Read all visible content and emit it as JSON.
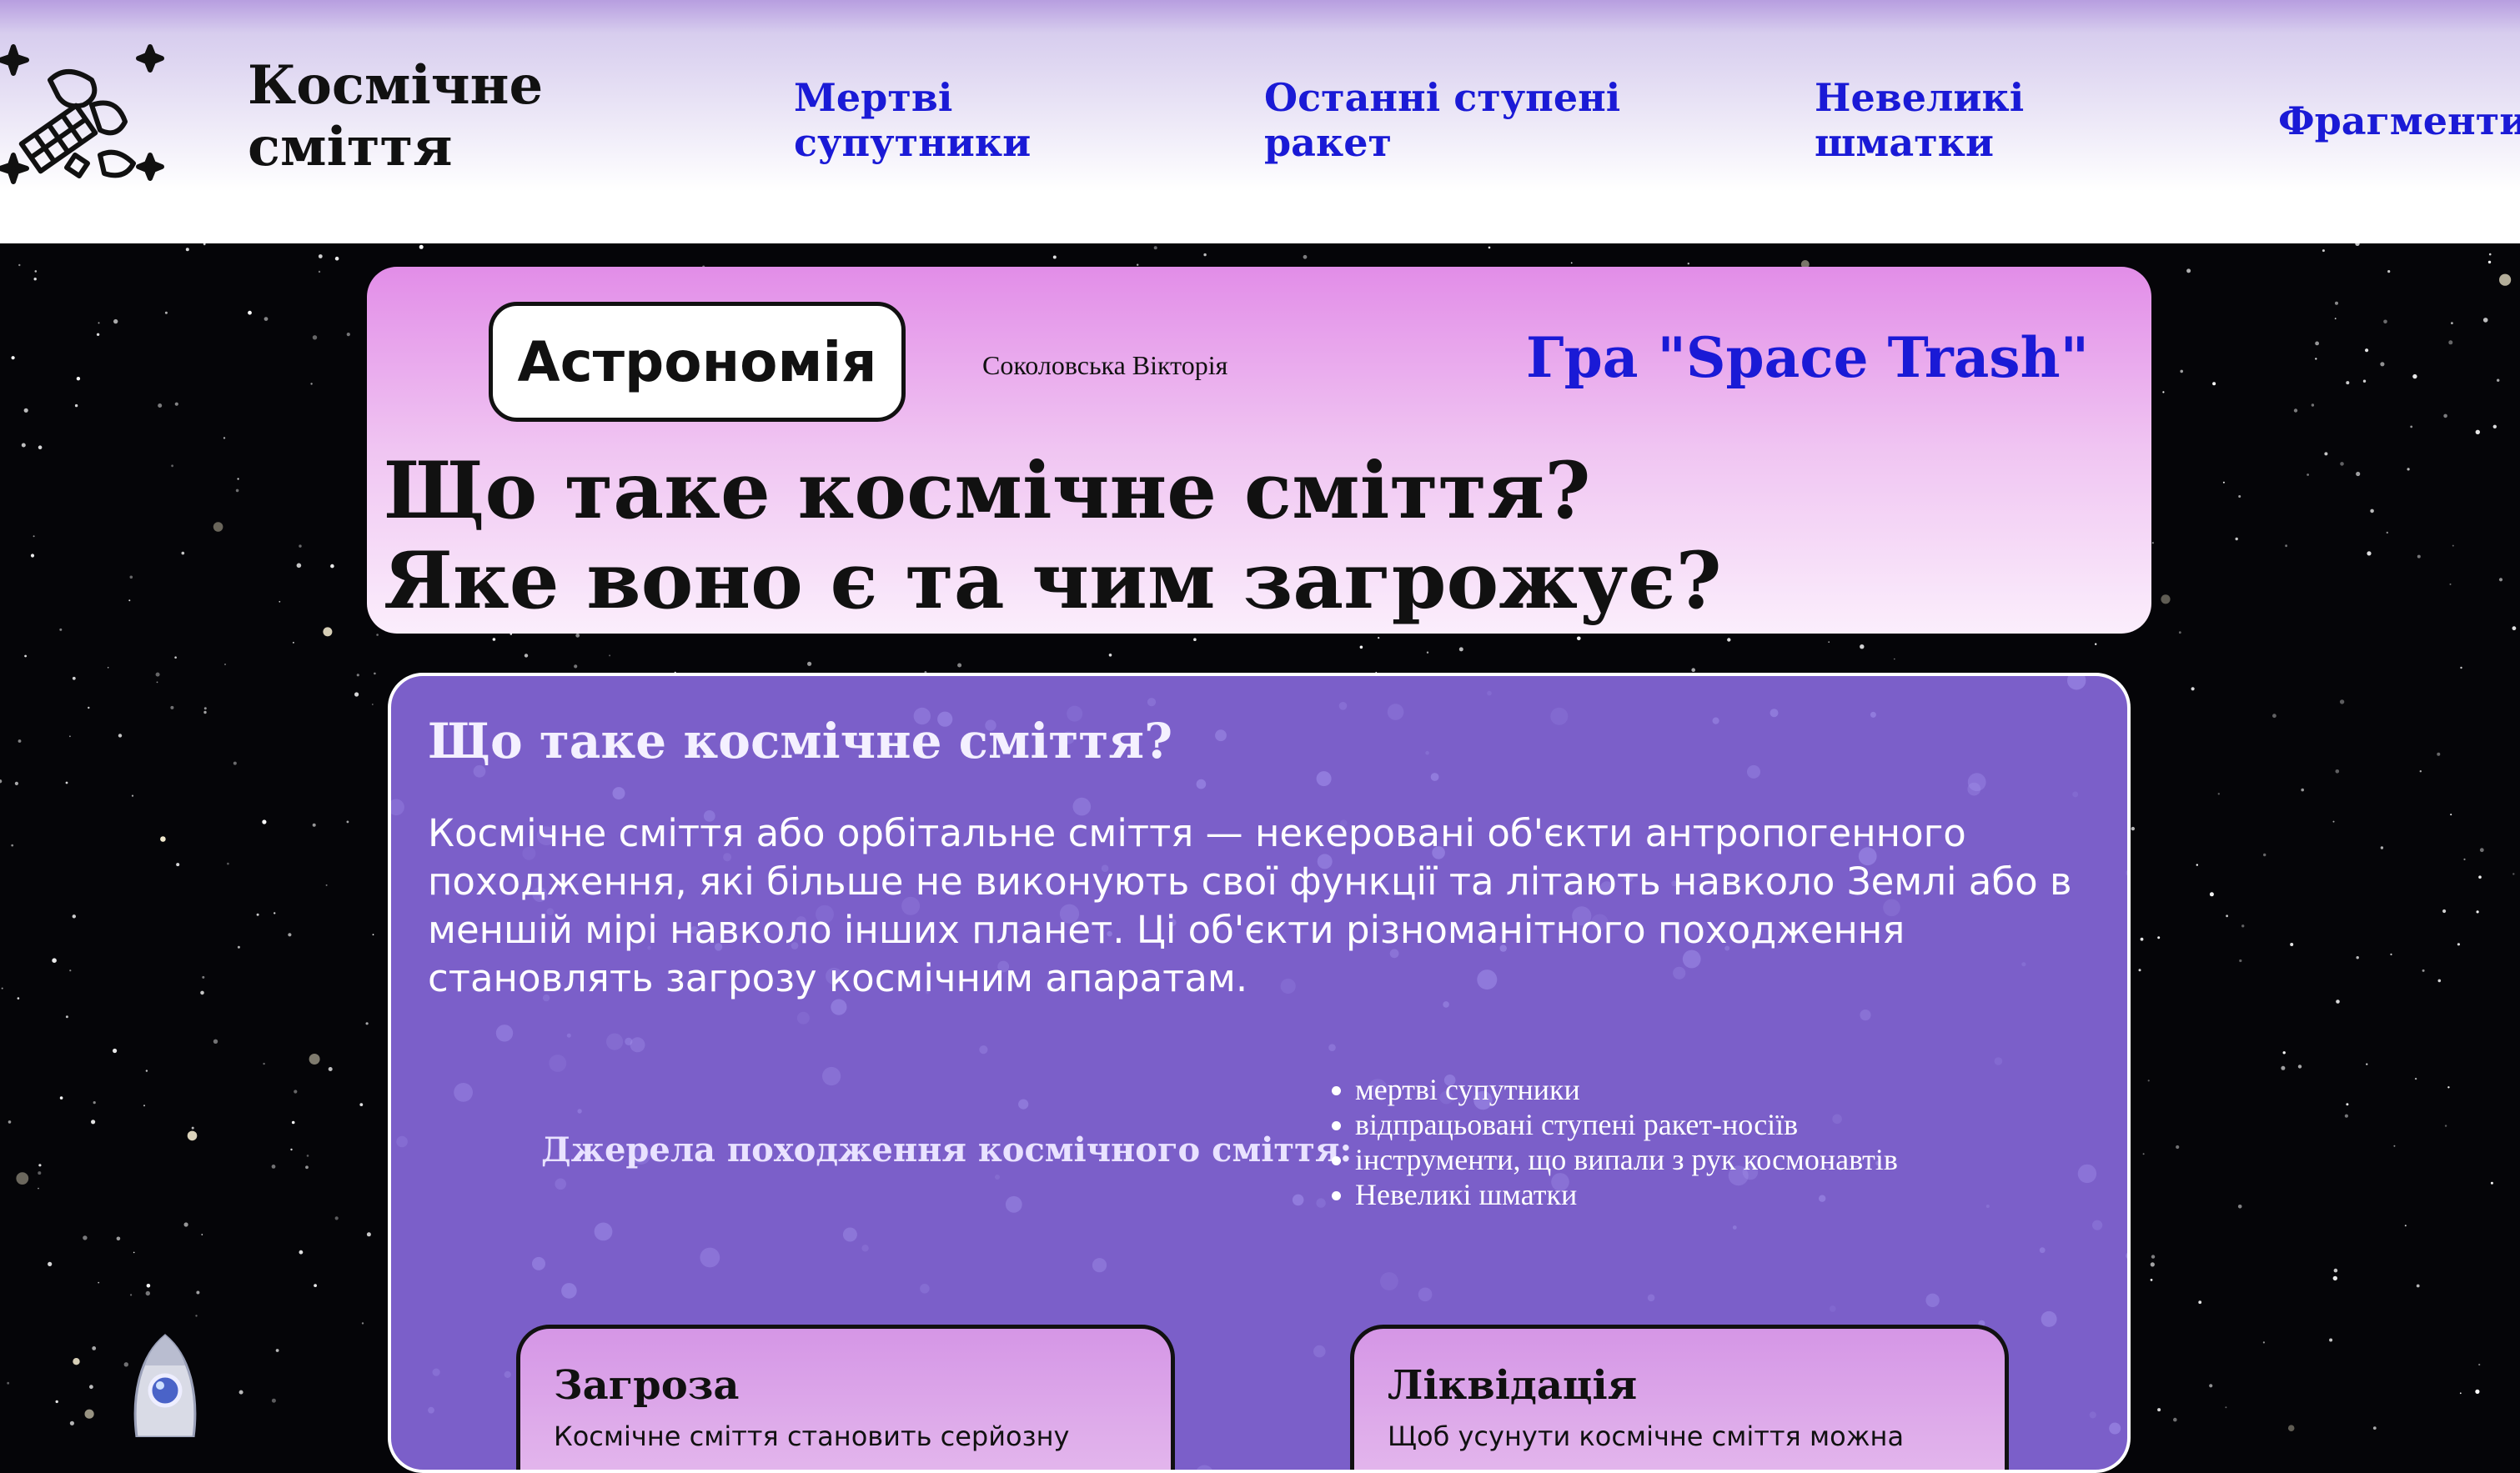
{
  "header": {
    "site_title": "Космічне сміття",
    "logo_icon": "space-debris-icon",
    "nav": [
      {
        "label": "Мертві супутники"
      },
      {
        "label": "Останні ступені ракет"
      },
      {
        "label": "Невеликі шматки"
      },
      {
        "label": "Фрагменти"
      }
    ]
  },
  "hero": {
    "subject_button": "Астрономія",
    "author": "Соколовська Вікторія",
    "game_link": "Гра \"Space Trash\"",
    "title_line1": "Що таке космічне сміття?",
    "title_line2": "Яке воно є та чим загрожує?"
  },
  "main": {
    "heading": "Що таке космічне сміття?",
    "paragraph": "Космічне сміття або орбітальне сміття — некеровані об'єкти антропогенного походження, які більше не виконують свої функції та літають навколо Землі або в меншій мірі навколо інших планет. Ці об'єкти різноманітного походження становлять загрозу космічним апаратам.",
    "sources_label": "Джерела походження космічного сміття:",
    "sources": [
      "мертві супутники",
      "відпрацьовані ступені ракет-носіїв",
      "інструменти, що випали з рук космонавтів",
      "Невеликі шматки"
    ],
    "cards": [
      {
        "title": "Загроза",
        "text": "Космічне сміття становить серйозну"
      },
      {
        "title": "Ліквідація",
        "text": "Щоб усунути космічне сміття можна"
      }
    ]
  },
  "colors": {
    "link": "#1a1ad6",
    "main_card": "#7b5fc9",
    "hero_top": "#e28de8",
    "background": "#050508"
  },
  "decor": {
    "rocket_icon": "rocket-icon"
  }
}
